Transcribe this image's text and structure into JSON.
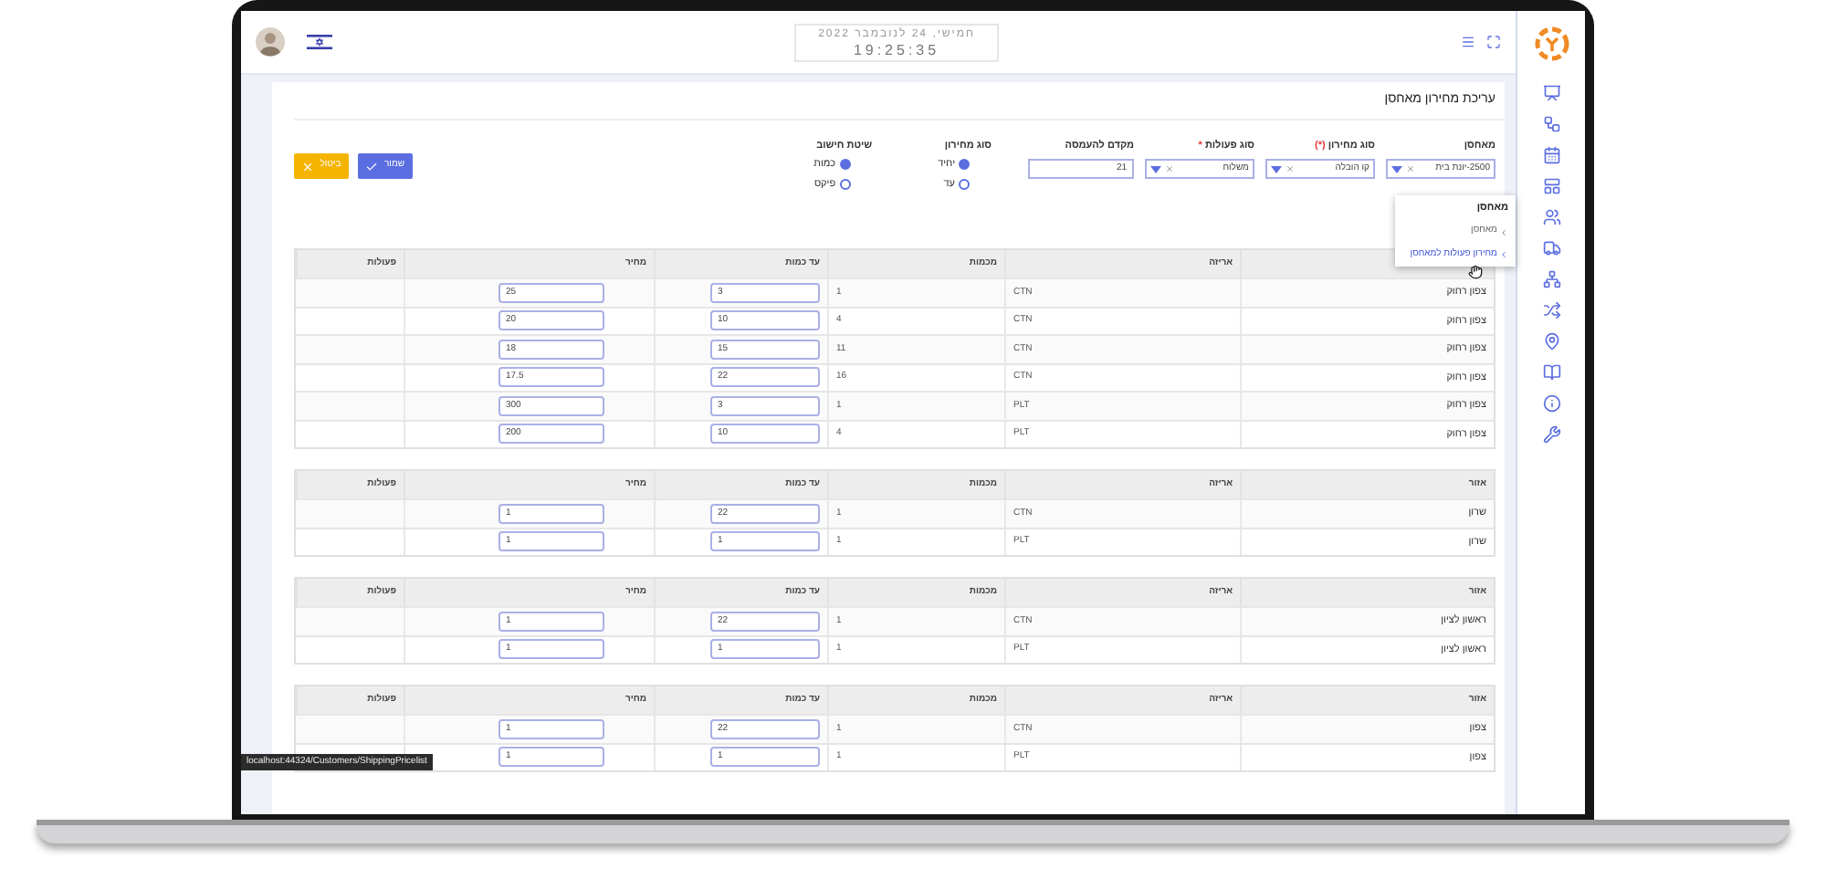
{
  "header": {
    "date": "חמישי, 24 לנובמבר 2022",
    "time": "19:25:35"
  },
  "page_title": "עריכת מחירון מאחסן",
  "filters": [
    {
      "kind": "select",
      "label": "מאחסן",
      "value": "2500-יונת בית"
    },
    {
      "kind": "select",
      "label": "סוג מחירון",
      "required_mark": "(*)",
      "value": "קו הובלה"
    },
    {
      "kind": "select",
      "label": "סוג פעולות",
      "required_mark": "*",
      "value": "משלוח"
    },
    {
      "kind": "input",
      "label": "מקדם להעמסה",
      "value": "21"
    }
  ],
  "radio_groups": [
    {
      "label": "סוג מחירון",
      "options": [
        {
          "label": "יחיד",
          "selected": true
        },
        {
          "label": "עד",
          "selected": false
        }
      ]
    },
    {
      "label": "שיטת חישוב",
      "options": [
        {
          "label": "כמות",
          "selected": true
        },
        {
          "label": "פיקס",
          "selected": false
        }
      ]
    }
  ],
  "buttons": [
    {
      "kind": "save",
      "label": "שמור"
    },
    {
      "kind": "cancel",
      "label": "ביטול"
    }
  ],
  "menu": {
    "title": "מאחסן",
    "items": [
      {
        "label": "מאחסן",
        "selected": false
      },
      {
        "label": "מחירון פעולות למאחסן",
        "selected": true
      }
    ]
  },
  "tables": [
    {
      "columns": [
        null,
        "אריזה",
        "מכמות",
        "עד כמות",
        "מחיר",
        "פעולות"
      ],
      "rows": [
        {
          "area": "צפון רחוק",
          "package": "CTN",
          "from": "1",
          "to": "3",
          "price": "25"
        },
        {
          "area": "צפון רחוק",
          "package": "CTN",
          "from": "4",
          "to": "10",
          "price": "20"
        },
        {
          "area": "צפון רחוק",
          "package": "CTN",
          "from": "11",
          "to": "15",
          "price": "18"
        },
        {
          "area": "צפון רחוק",
          "package": "CTN",
          "from": "16",
          "to": "22",
          "price": "17.5"
        },
        {
          "area": "צפון רחוק",
          "package": "PLT",
          "from": "1",
          "to": "3",
          "price": "300"
        },
        {
          "area": "צפון רחוק",
          "package": "PLT",
          "from": "4",
          "to": "10",
          "price": "200"
        }
      ]
    },
    {
      "columns": [
        "אזור",
        "אריזה",
        "מכמות",
        "עד כמות",
        "מחיר",
        "פעולות"
      ],
      "rows": [
        {
          "area": "שרון",
          "package": "CTN",
          "from": "1",
          "to": "22",
          "price": "1"
        },
        {
          "area": "שרון",
          "package": "PLT",
          "from": "1",
          "to": "1",
          "price": "1"
        }
      ]
    },
    {
      "columns": [
        "אזור",
        "אריזה",
        "מכמות",
        "עד כמות",
        "מחיר",
        "פעולות"
      ],
      "rows": [
        {
          "area": "ראשון לציון",
          "package": "CTN",
          "from": "1",
          "to": "22",
          "price": "1"
        },
        {
          "area": "ראשון לציון",
          "package": "PLT",
          "from": "1",
          "to": "1",
          "price": "1"
        }
      ]
    },
    {
      "columns": [
        "אזור",
        "אריזה",
        "מכמות",
        "עד כמות",
        "מחיר",
        "פעולות"
      ],
      "rows": [
        {
          "area": "צפון",
          "package": "CTN",
          "from": "1",
          "to": "22",
          "price": "1"
        },
        {
          "area": "צפון",
          "package": "PLT",
          "from": "1",
          "to": "1",
          "price": "1"
        }
      ]
    }
  ],
  "status_url": "localhost:44324/Customers/ShippingPricelist"
}
